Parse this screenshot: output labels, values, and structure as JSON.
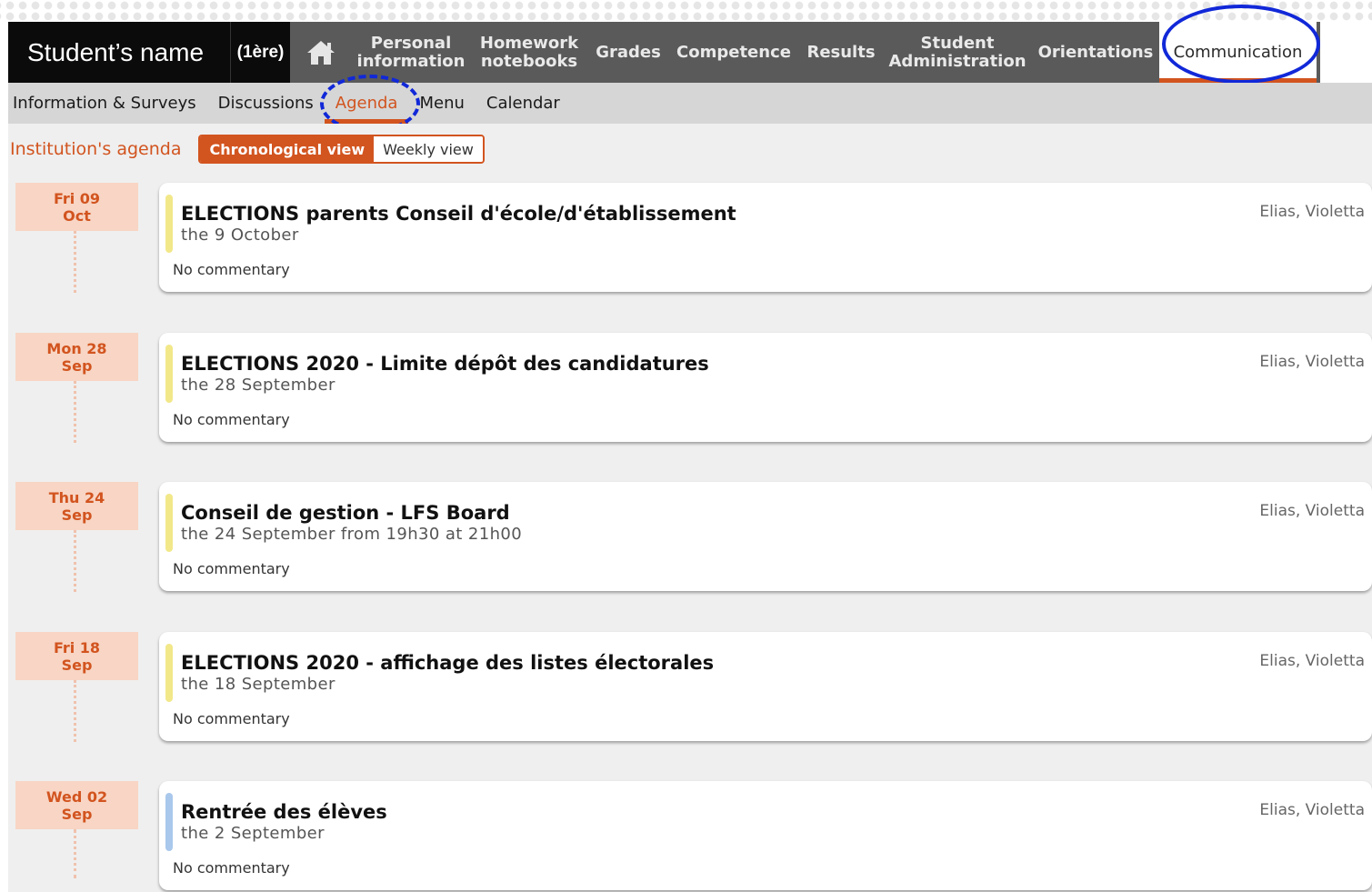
{
  "header": {
    "student_name": "Student’s name",
    "class_label": "(1ère)",
    "home_icon": "home-icon",
    "nav": [
      {
        "label": "Personal information"
      },
      {
        "label": "Homework notebooks"
      },
      {
        "label": "Grades"
      },
      {
        "label": "Competence"
      },
      {
        "label": "Results"
      },
      {
        "label": "Student Administration"
      },
      {
        "label": "Orientations"
      },
      {
        "label": "Communication"
      }
    ],
    "active_nav": "Communication"
  },
  "subnav": {
    "items": [
      {
        "label": "Information & Surveys"
      },
      {
        "label": "Discussions"
      },
      {
        "label": "Agenda"
      },
      {
        "label": "Menu"
      },
      {
        "label": "Calendar"
      }
    ],
    "active": "Agenda"
  },
  "agenda": {
    "title": "Institution's agenda",
    "views": {
      "chronological": "Chronological view",
      "weekly": "Weekly view"
    },
    "active_view": "Chronological view"
  },
  "events": [
    {
      "day": "Fri 09",
      "month": "Oct",
      "title": "ELECTIONS parents Conseil d'école/d'établissement",
      "when": "the 9 October",
      "comment": "No commentary",
      "author": "Elias, Violetta",
      "stripe_color": "#f2e88a"
    },
    {
      "day": "Mon 28",
      "month": "Sep",
      "title": "ELECTIONS 2020 - Limite dépôt des candidatures",
      "when": "the 28 September",
      "comment": "No commentary",
      "author": "Elias, Violetta",
      "stripe_color": "#f2e88a"
    },
    {
      "day": "Thu 24",
      "month": "Sep",
      "title": "Conseil de gestion - LFS Board",
      "when": "the 24 September from 19h30 at 21h00",
      "comment": "No commentary",
      "author": "Elias, Violetta",
      "stripe_color": "#f2e88a"
    },
    {
      "day": "Fri 18",
      "month": "Sep",
      "title": "ELECTIONS 2020 - affichage des listes électorales",
      "when": "the 18 September",
      "comment": "No commentary",
      "author": "Elias, Violetta",
      "stripe_color": "#f2e88a"
    },
    {
      "day": "Wed 02",
      "month": "Sep",
      "title": "Rentrée des élèves",
      "when": "the 2 September",
      "comment": "No commentary",
      "author": "Elias, Violetta",
      "stripe_color": "#a9c8ec"
    }
  ],
  "colors": {
    "accent": "#d2541f",
    "annotation": "#1128d8"
  }
}
